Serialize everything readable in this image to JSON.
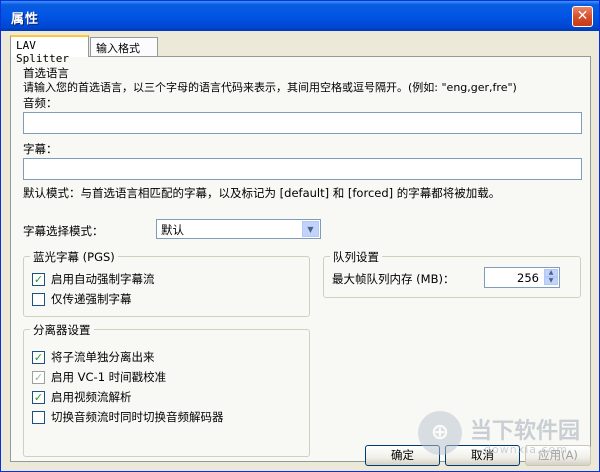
{
  "window": {
    "title": "属性",
    "close_glyph": "✕"
  },
  "tabs": [
    {
      "label": "LAV Splitter",
      "active": true
    },
    {
      "label": "输入格式",
      "active": false
    }
  ],
  "language": {
    "section_title": "首选语言",
    "description": "请输入您的首选语言，以三个字母的语言代码来表示，其间用空格或逗号隔开。(例如: \"eng,ger,fre\")",
    "audio_label": "音频：",
    "audio_value": "",
    "subtitle_label": "字幕：",
    "subtitle_value": "",
    "default_mode_note": "默认模式：与首选语言相匹配的字幕，以及标记为 [default] 和 [forced] 的字幕都将被加载。"
  },
  "subtitle_mode": {
    "label": "字幕选择模式：",
    "selected": "默认"
  },
  "pgs_group": {
    "title": "蓝光字幕 (PGS)",
    "options": [
      {
        "label": "启用自动强制字幕流",
        "checked": true
      },
      {
        "label": "仅传递强制字幕",
        "checked": false
      }
    ]
  },
  "queue_group": {
    "title": "队列设置",
    "max_queue_label": "最大帧队列内存 (MB)：",
    "max_queue_value": "256"
  },
  "splitter_group": {
    "title": "分离器设置",
    "options": [
      {
        "label": "将子流单独分离出来",
        "checked": true
      },
      {
        "label": "启用 VC-1 时间戳校准",
        "checked": true
      },
      {
        "label": "启用视频流解析",
        "checked": true
      },
      {
        "label": "切换音频流时同时切换音频解码器",
        "checked": false
      }
    ]
  },
  "buttons": {
    "ok": "确定",
    "cancel": "取消",
    "apply": "应用(A)"
  },
  "watermark": {
    "logo_glyph": "⊕",
    "text": "当下软件园",
    "url": "downxia.com"
  },
  "colors": {
    "titlebar": "#0055e5",
    "check_mark": "#21a121",
    "face": "#ece9d8"
  }
}
